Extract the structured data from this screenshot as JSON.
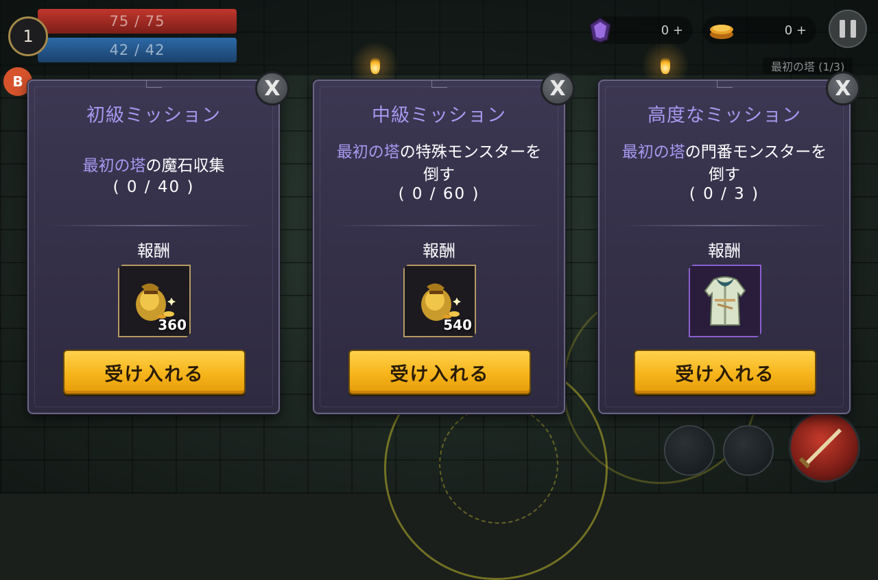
{
  "hud": {
    "level": "1",
    "hp_text": "75 / 75",
    "mp_text": "42 / 42",
    "gems": "0 +",
    "coins": "0 +",
    "floor_label": "最初の塔 (1/3)",
    "badge_letter": "B"
  },
  "cards": [
    {
      "title": "初級ミッション",
      "desc_highlight": "最初の塔",
      "desc_rest": "の魔石収集",
      "desc_line2": "",
      "progress": "( 0 / 40 )",
      "reward_label": "報酬",
      "reward_icon": "gold-bag-icon",
      "reward_qty": "360",
      "accept_label": "受け入れる",
      "close_label": "X"
    },
    {
      "title": "中級ミッション",
      "desc_highlight": "最初の塔",
      "desc_rest": "の特殊モンスターを",
      "desc_line2": "倒す",
      "progress": "( 0 / 60 )",
      "reward_label": "報酬",
      "reward_icon": "gold-bag-icon",
      "reward_qty": "540",
      "accept_label": "受け入れる",
      "close_label": "X"
    },
    {
      "title": "高度なミッション",
      "desc_highlight": "最初の塔",
      "desc_rest": "の門番モンスターを",
      "desc_line2": "倒す",
      "progress": "( 0 / 3 )",
      "reward_label": "報酬",
      "reward_icon": "robe-armor-icon",
      "reward_qty": "",
      "accept_label": "受け入れる",
      "close_label": "X"
    }
  ],
  "colors": {
    "title_purple": "#a699f0",
    "card_bg": "#3c3752",
    "accept_gold": "#f6b41a",
    "hp_red": "#c0362c",
    "mp_blue": "#2d6aa8"
  }
}
